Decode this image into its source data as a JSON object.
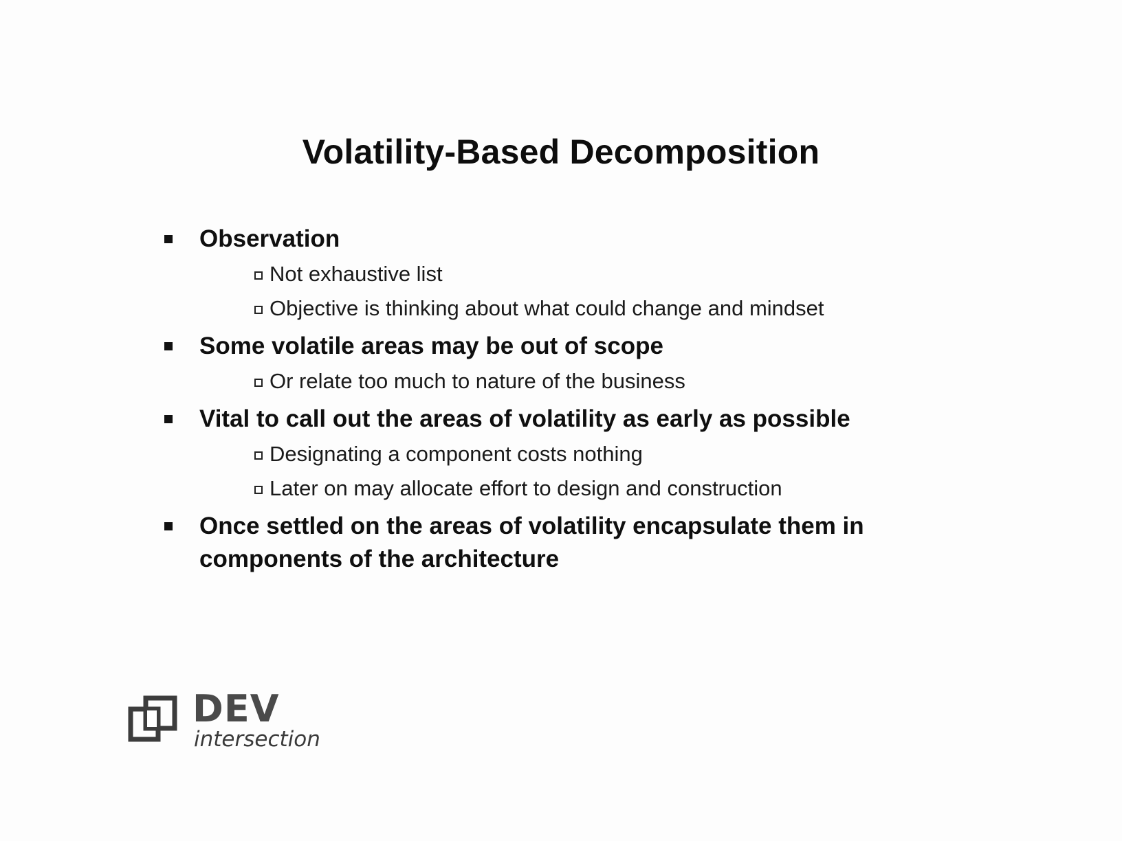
{
  "slide": {
    "title": "Volatility-Based Decomposition",
    "bullets": [
      {
        "text": "Observation",
        "subitems": [
          "Not exhaustive list",
          "Objective is thinking about what could change and mindset"
        ]
      },
      {
        "text": "Some volatile areas may be out of scope",
        "subitems": [
          "Or relate too much to nature of the business"
        ]
      },
      {
        "text": "Vital to call out the areas of volatility as early as possible",
        "subitems": [
          "Designating a component costs nothing",
          "Later on may allocate effort to design and construction"
        ]
      },
      {
        "text": "Once settled on the areas of volatility encapsulate them in components of the architecture",
        "subitems": []
      }
    ]
  },
  "logo": {
    "name": "DEV",
    "subtitle": "intersection",
    "icon": "interlocking-squares-logo-icon"
  }
}
